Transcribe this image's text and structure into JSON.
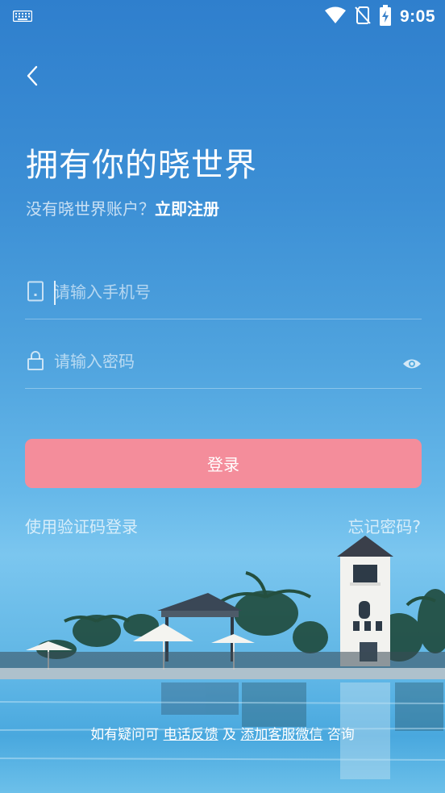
{
  "status_bar": {
    "time": "9:05",
    "icons": [
      "keyboard-icon",
      "wifi-icon",
      "no-sim-icon",
      "battery-charging-icon"
    ]
  },
  "header": {
    "back_icon": "chevron-left-icon",
    "title": "拥有你的晓世界",
    "no_account_text": "没有晓世界账户？",
    "register_link": "立即注册"
  },
  "form": {
    "phone": {
      "icon": "phone-icon",
      "placeholder": "请输入手机号",
      "value": ""
    },
    "password": {
      "icon": "lock-icon",
      "placeholder": "请输入密码",
      "value": "",
      "toggle_icon": "eye-icon"
    },
    "login_button": "登录",
    "login_button_color": "#f48d9b"
  },
  "links": {
    "verification_login": "使用验证码登录",
    "forgot_password": "忘记密码?"
  },
  "footer": {
    "prefix": "如有疑问可",
    "phone_feedback": "电话反馈",
    "and": "及",
    "add_wechat": "添加客服微信",
    "suffix": "咨询"
  }
}
